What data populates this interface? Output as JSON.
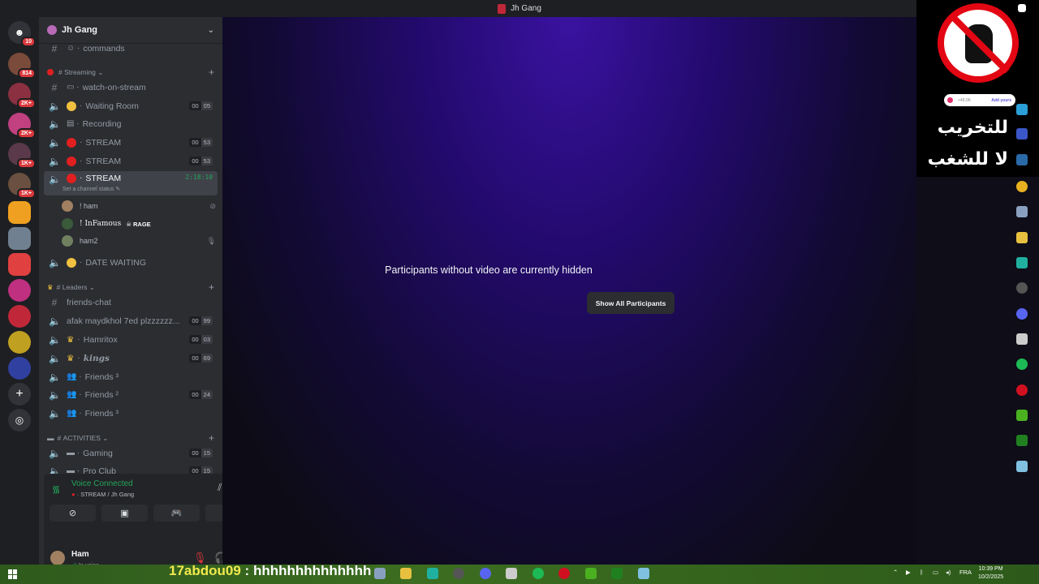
{
  "window": {
    "title": "Jh Gang"
  },
  "rail": {
    "home_badge": "10",
    "servers": [
      {
        "badge": "814",
        "color": "#7a4a3a"
      },
      {
        "badge": "2K+",
        "color": "#8a3040"
      },
      {
        "badge": "2K+",
        "color": "#c04080"
      },
      {
        "badge": "1K+",
        "color": "#5a3a4a"
      },
      {
        "badge": "1K+",
        "color": "#6a5040"
      },
      {
        "badge": "",
        "color": "#f0a020"
      },
      {
        "badge": "",
        "color": "#708090"
      },
      {
        "badge": "",
        "color": "#e04040"
      },
      {
        "badge": "",
        "color": "#c03080"
      },
      {
        "badge": "",
        "color": "#c0283a"
      },
      {
        "badge": "",
        "color": "#c0a020"
      },
      {
        "badge": "",
        "color": "#3040a0"
      }
    ]
  },
  "guild": {
    "name": "Jh Gang"
  },
  "channels": {
    "commands": "commands",
    "cat_streaming": "Streaming",
    "watch_on_stream": "watch-on-stream",
    "waiting_room": {
      "name": "Waiting Room",
      "a": "00",
      "b": "05"
    },
    "recording": "Recording",
    "stream1": {
      "name": "STREAM",
      "a": "00",
      "b": "53"
    },
    "stream2": {
      "name": "STREAM",
      "a": "00",
      "b": "53"
    },
    "stream_active": {
      "name": "STREAM",
      "timer": "2:18:10",
      "status": "Set a channel status"
    },
    "users": [
      "! ham",
      "! InFamous",
      "ham2"
    ],
    "rage_tag": "RAGE",
    "date_waiting": "DATE WAITING",
    "cat_leaders": "Leaders",
    "friends_chat": "friends-chat",
    "afak": {
      "name": "afak maydkhol 7ed plzzzzzz...",
      "a": "00",
      "b": "99"
    },
    "hamritox": {
      "name": "Hamritox",
      "a": "00",
      "b": "03"
    },
    "kings": {
      "name": "kings",
      "a": "00",
      "b": "69"
    },
    "friends3a": "Friends ³",
    "friends2": {
      "name": "Friends ²",
      "a": "00",
      "b": "24"
    },
    "friends3b": "Friends ³",
    "cat_activities": "ACTIVITIES",
    "gaming": {
      "name": "Gaming",
      "a": "00",
      "b": "15"
    },
    "pro_club": {
      "name": "Pro Club",
      "a": "00",
      "b": "15"
    }
  },
  "voice": {
    "status": "Voice Connected",
    "location": "STREAM / Jh Gang"
  },
  "user": {
    "name": "Ham",
    "status": "In voice"
  },
  "stage": {
    "message": "Participants without video are currently hidden",
    "button": "Show All Participants"
  },
  "overlay": {
    "pill_count": "+48.9K",
    "pill_action": "Add yours",
    "line1": "للتخريب",
    "line2": "لا للشغب"
  },
  "taskbar": {
    "ticker_user": "17abdou09",
    "ticker_sep": ":",
    "ticker_msg": "hhhhhhhhhhhhhh",
    "lang": "FRA",
    "time": "10:39 PM",
    "date": "10/2/2025"
  },
  "colors": {
    "accent_green": "#23a55a",
    "stream_red": "#e02020",
    "stage_purple": "#3a12a0"
  }
}
